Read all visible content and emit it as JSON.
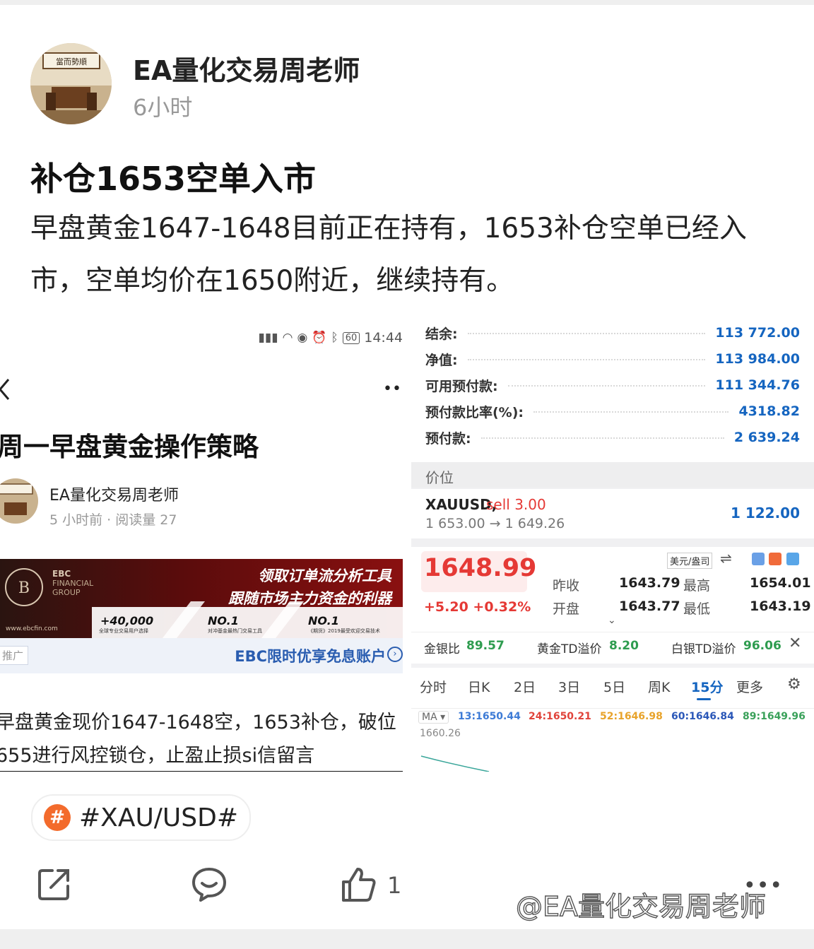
{
  "post": {
    "author": "EA量化交易周老师",
    "time": "6小时",
    "title": "补仓1653空单入市",
    "body": "早盘黄金1647-1648目前正在持有，1653补仓空单已经入市，空单均价在1650附近，继续持有。",
    "avatar_sign": "當而勢順"
  },
  "left_shot": {
    "status_time": "14:44",
    "battery": "60",
    "article_title": "周一早盘黄金操作策略",
    "author": "EA量化交易周老师",
    "meta": "5 小时前 · 阅读量 27",
    "banner": {
      "logo": "EBC",
      "logo_sub": "FINANCIAL GROUP",
      "line1": "领取订单流分析工具",
      "line2": "跟随市场主力资金的利器",
      "stat1": "+40,000",
      "stat1_sub": "全球专业交易用户选择",
      "stat2": "NO.1",
      "stat2_sub": "对冲基金最热门交易工具",
      "stat3": "NO.1",
      "stat3_sub": "《期货》2019最受欢迎交易技术",
      "url": "www.ebcfin.com"
    },
    "promo_tag": "推广",
    "promo_text": "EBC限时优享免息账户",
    "text_line1": "早盘黄金现价1647-1648空，1653补仓，破位",
    "text_line2": "655进行风控锁仓，止盈止损si信留言"
  },
  "right_shot": {
    "account": [
      {
        "label": "结余:",
        "value": "113 772.00"
      },
      {
        "label": "净值:",
        "value": "113 984.00"
      },
      {
        "label": "可用预付款:",
        "value": "111 344.76"
      },
      {
        "label": "预付款比率(%):",
        "value": "4318.82"
      },
      {
        "label": "预付款:",
        "value": "2 639.24"
      }
    ],
    "positions_header": "价位",
    "position": {
      "symbol": "XAUUSD,",
      "side": "sell 3.00",
      "prices": "1 653.00 → 1 649.26",
      "profit": "1 122.00"
    },
    "quote": {
      "price": "1648.99",
      "change": "+5.20 +0.32%",
      "unit": "美元/盎司",
      "prev_close_label": "昨收",
      "prev_close": "1643.79",
      "high_label": "最高",
      "high": "1654.01",
      "open_label": "开盘",
      "open": "1643.77",
      "low_label": "最低",
      "low": "1643.19",
      "ratios": [
        {
          "label": "金银比",
          "value": "89.57"
        },
        {
          "label": "黄金TD溢价",
          "value": "8.20"
        },
        {
          "label": "白银TD溢价",
          "value": "96.06"
        }
      ],
      "tabs": [
        "分时",
        "日K",
        "2日",
        "3日",
        "5日",
        "周K",
        "15分",
        "更多"
      ],
      "active_tab": "15分",
      "ma_label": "MA",
      "ma": [
        {
          "label": "13:1650.44",
          "color": "#3d7bd6"
        },
        {
          "label": "24:1650.21",
          "color": "#e0433a"
        },
        {
          "label": "52:1646.98",
          "color": "#e8a32a"
        },
        {
          "label": "60:1646.84",
          "color": "#2a57b8"
        },
        {
          "label": "89:1649.96",
          "color": "#3aa15a"
        }
      ],
      "axis_top": "1660.26"
    }
  },
  "tag": {
    "label": "#XAU/USD#"
  },
  "actions": {
    "like_count": "1"
  },
  "watermark": "@EA量化交易周老师",
  "colors": {
    "up": "#e53935",
    "blue": "#1565c0",
    "tag": "#f36b2c"
  }
}
